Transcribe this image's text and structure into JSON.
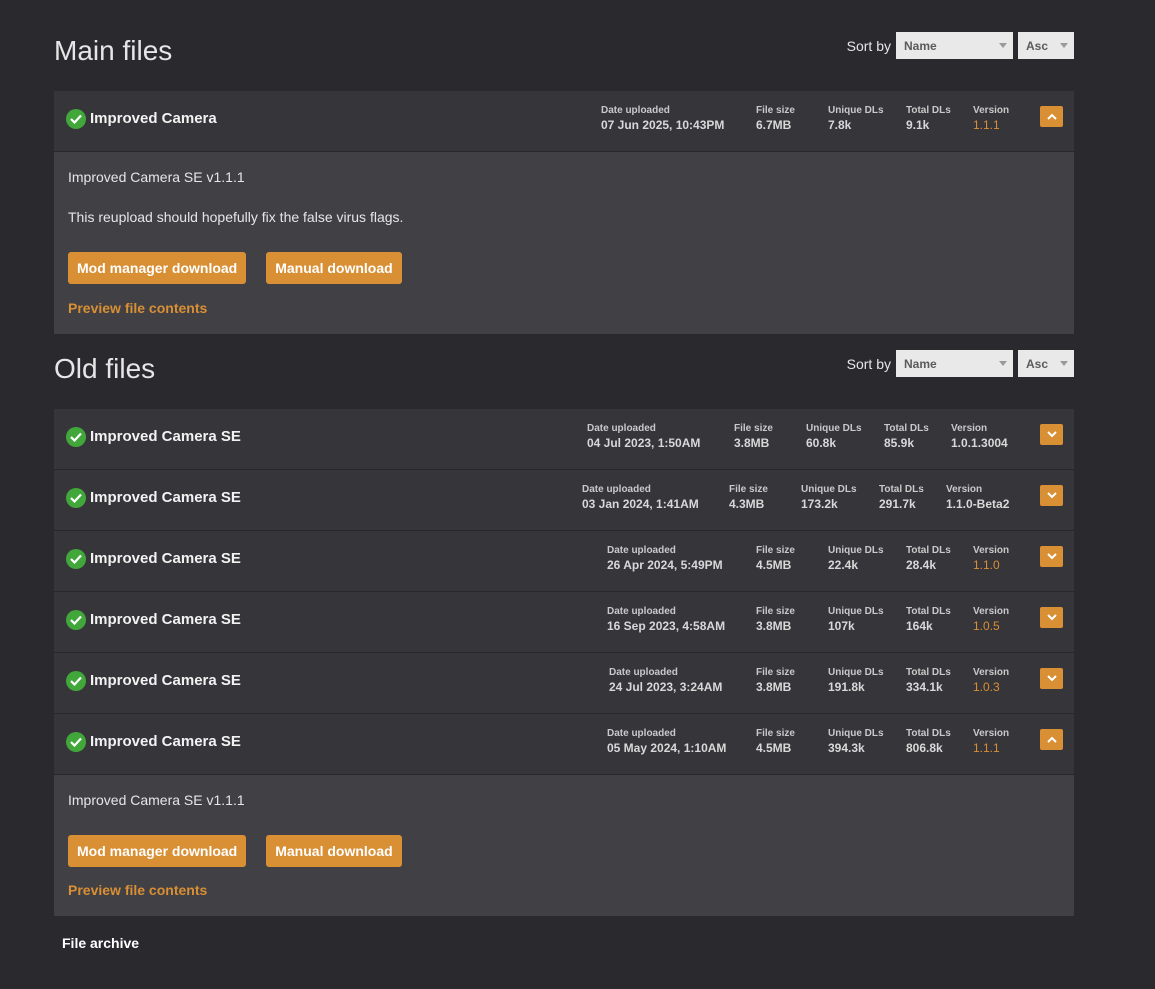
{
  "main": {
    "title": "Main files",
    "sort_label": "Sort by",
    "sort_field": "Name",
    "sort_order": "Asc",
    "file": {
      "name": "Improved Camera",
      "date_label": "Date uploaded",
      "date": "07 Jun 2025, 10:43PM",
      "size_label": "File size",
      "size": "6.7MB",
      "unique_label": "Unique DLs",
      "unique": "7.8k",
      "total_label": "Total DLs",
      "total": "9.1k",
      "version_label": "Version",
      "version": "1.1.1",
      "desc_line1": "Improved Camera SE v1.1.1",
      "desc_line2": "This reupload should hopefully fix the false virus flags.",
      "mod_manager_label": "Mod manager download",
      "manual_label": "Manual download",
      "preview_label": "Preview file contents"
    }
  },
  "old": {
    "title": "Old files",
    "sort_label": "Sort by",
    "sort_field": "Name",
    "sort_order": "Asc",
    "files": [
      {
        "name": "Improved Camera SE",
        "date_label": "Date uploaded",
        "date": "04 Jul 2023, 1:50AM",
        "size_label": "File size",
        "size": "3.8MB",
        "unique_label": "Unique DLs",
        "unique": "60.8k",
        "total_label": "Total DLs",
        "total": "85.9k",
        "version_label": "Version",
        "version": "1.0.1.3004"
      },
      {
        "name": "Improved Camera SE",
        "date_label": "Date uploaded",
        "date": "03 Jan 2024, 1:41AM",
        "size_label": "File size",
        "size": "4.3MB",
        "unique_label": "Unique DLs",
        "unique": "173.2k",
        "total_label": "Total DLs",
        "total": "291.7k",
        "version_label": "Version",
        "version": "1.1.0-Beta2"
      },
      {
        "name": "Improved Camera SE",
        "date_label": "Date uploaded",
        "date": "26 Apr 2024, 5:49PM",
        "size_label": "File size",
        "size": "4.5MB",
        "unique_label": "Unique DLs",
        "unique": "22.4k",
        "total_label": "Total DLs",
        "total": "28.4k",
        "version_label": "Version",
        "version": "1.1.0"
      },
      {
        "name": "Improved Camera SE",
        "date_label": "Date uploaded",
        "date": "16 Sep 2023, 4:58AM",
        "size_label": "File size",
        "size": "3.8MB",
        "unique_label": "Unique DLs",
        "unique": "107k",
        "total_label": "Total DLs",
        "total": "164k",
        "version_label": "Version",
        "version": "1.0.5"
      },
      {
        "name": "Improved Camera SE",
        "date_label": "Date uploaded",
        "date": "24 Jul 2023, 3:24AM",
        "size_label": "File size",
        "size": "3.8MB",
        "unique_label": "Unique DLs",
        "unique": "191.8k",
        "total_label": "Total DLs",
        "total": "334.1k",
        "version_label": "Version",
        "version": "1.0.3"
      },
      {
        "name": "Improved Camera SE",
        "date_label": "Date uploaded",
        "date": "05 May 2024, 1:10AM",
        "size_label": "File size",
        "size": "4.5MB",
        "unique_label": "Unique DLs",
        "unique": "394.3k",
        "total_label": "Total DLs",
        "total": "806.8k",
        "version_label": "Version",
        "version": "1.1.1"
      }
    ],
    "expanded": {
      "desc_line1": "Improved Camera SE v1.1.1",
      "mod_manager_label": "Mod manager download",
      "manual_label": "Manual download",
      "preview_label": "Preview file contents"
    }
  },
  "archive_label": "File archive",
  "colors": {
    "accent": "#d98f34",
    "check": "#42a73a",
    "background": "#2a292e",
    "panel": "#36353a"
  }
}
